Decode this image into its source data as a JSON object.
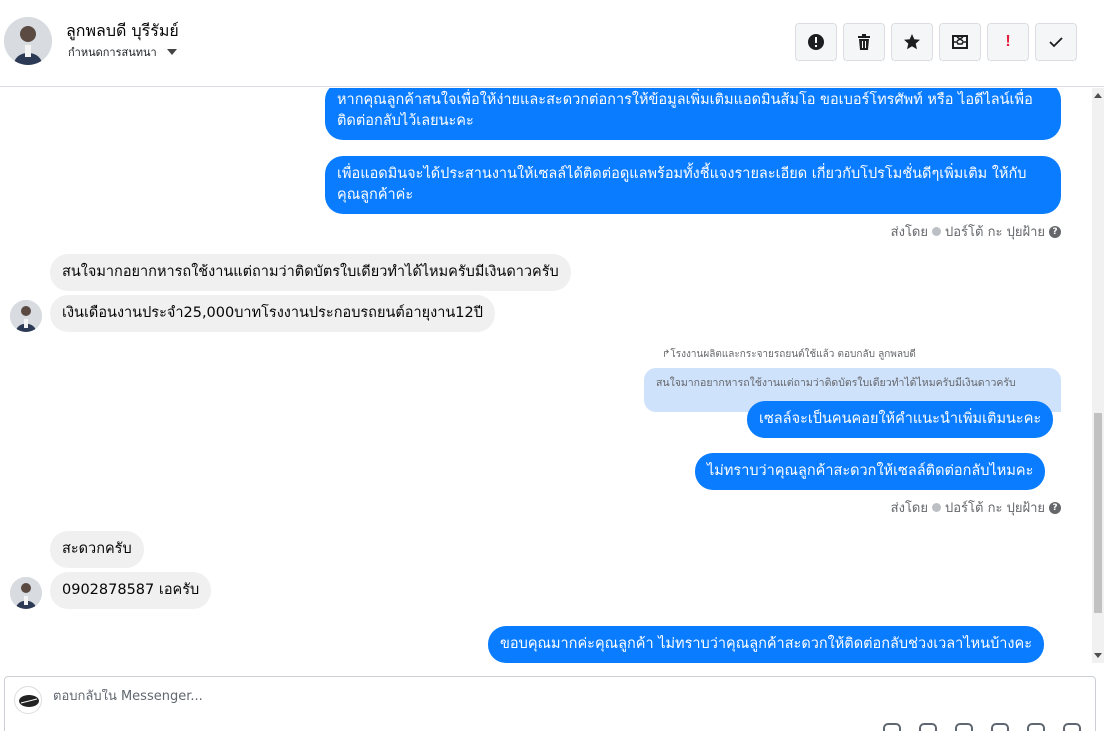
{
  "header": {
    "contact_name": "ลูกพลบดี บุรีรัมย์",
    "assign_label": "กำหนดการสนทนา",
    "toolbar": [
      {
        "name": "spam-button",
        "icon": "exclamation-circle-icon"
      },
      {
        "name": "delete-button",
        "icon": "trash-icon"
      },
      {
        "name": "star-button",
        "icon": "star-icon"
      },
      {
        "name": "mark-unread-button",
        "icon": "envelope-x-icon"
      },
      {
        "name": "important-button",
        "icon": "exclamation-icon",
        "label": "!"
      },
      {
        "name": "done-button",
        "icon": "check-icon"
      }
    ]
  },
  "messages": {
    "m1": "หากคุณลูกค้าสนใจเพื่อให้ง่ายและสะดวกต่อการให้ข้อมูลเพิ่มเติมแอดมินส้มโอ ขอเบอร์โทรศัพท์ หรือ ไอดีไลน์เพื่อติดต่อกลับไว้เลยนะคะ",
    "m2": "เพื่อแอดมินจะได้ประสานงานให้เซลล์ได้ติดต่อดูแลพร้อมทั้งชี้แจงรายละเอียด เกี่ยวกับโปรโมชั่นดีๆเพิ่มเติม ให้กับคุณลูกค้าค่ะ",
    "meta1_sent_by": "ส่งโดย",
    "meta1_sender": "ปอร์โต้ กะ ปุยฝ้าย",
    "m3": "สนใจมากอยากหารถใช้งานแต่ถามว่าติดบัตรใบเดียวทำได้ไหมครับมีเงินดาวครับ",
    "m4": "เงินเดือนงานประจำ25,000บาทโรงงานประกอบรถยนต์อายุงาน12ปี",
    "reply_label": "โรงงานผลิตและกระจายรถยนต์ใช้แล้ว ตอบกลับ ลูกพลบดี",
    "reply_quote": "สนใจมากอยากหารถใช้งานแต่ถามว่าติดบัตรใบเดียวทำได้ไหมครับมีเงินดาวครับ",
    "m5": "เซลล์จะเป็นคนคอยให้คำแนะนำเพิ่มเติมนะคะ",
    "m6": "ไม่ทราบว่าคุณลูกค้าสะดวกให้เซลล์ติดต่อกลับไหมคะ",
    "meta2_sent_by": "ส่งโดย",
    "meta2_sender": "ปอร์โต้ กะ ปุยฝ้าย",
    "m7": "สะดวกครับ",
    "m8": "0902878587 เอครับ",
    "m9": "ขอบคุณมากค่ะคุณลูกค้า ไม่ทราบว่าคุณลูกค้าสะดวกให้ติดต่อกลับช่วงเวลาไหนบ้างคะ"
  },
  "composer": {
    "placeholder": "ตอบกลับใน Messenger..."
  },
  "colors": {
    "outgoing": "#0a7cff",
    "incoming": "#f0f0f0",
    "reply_quote": "#cfe2fb"
  }
}
